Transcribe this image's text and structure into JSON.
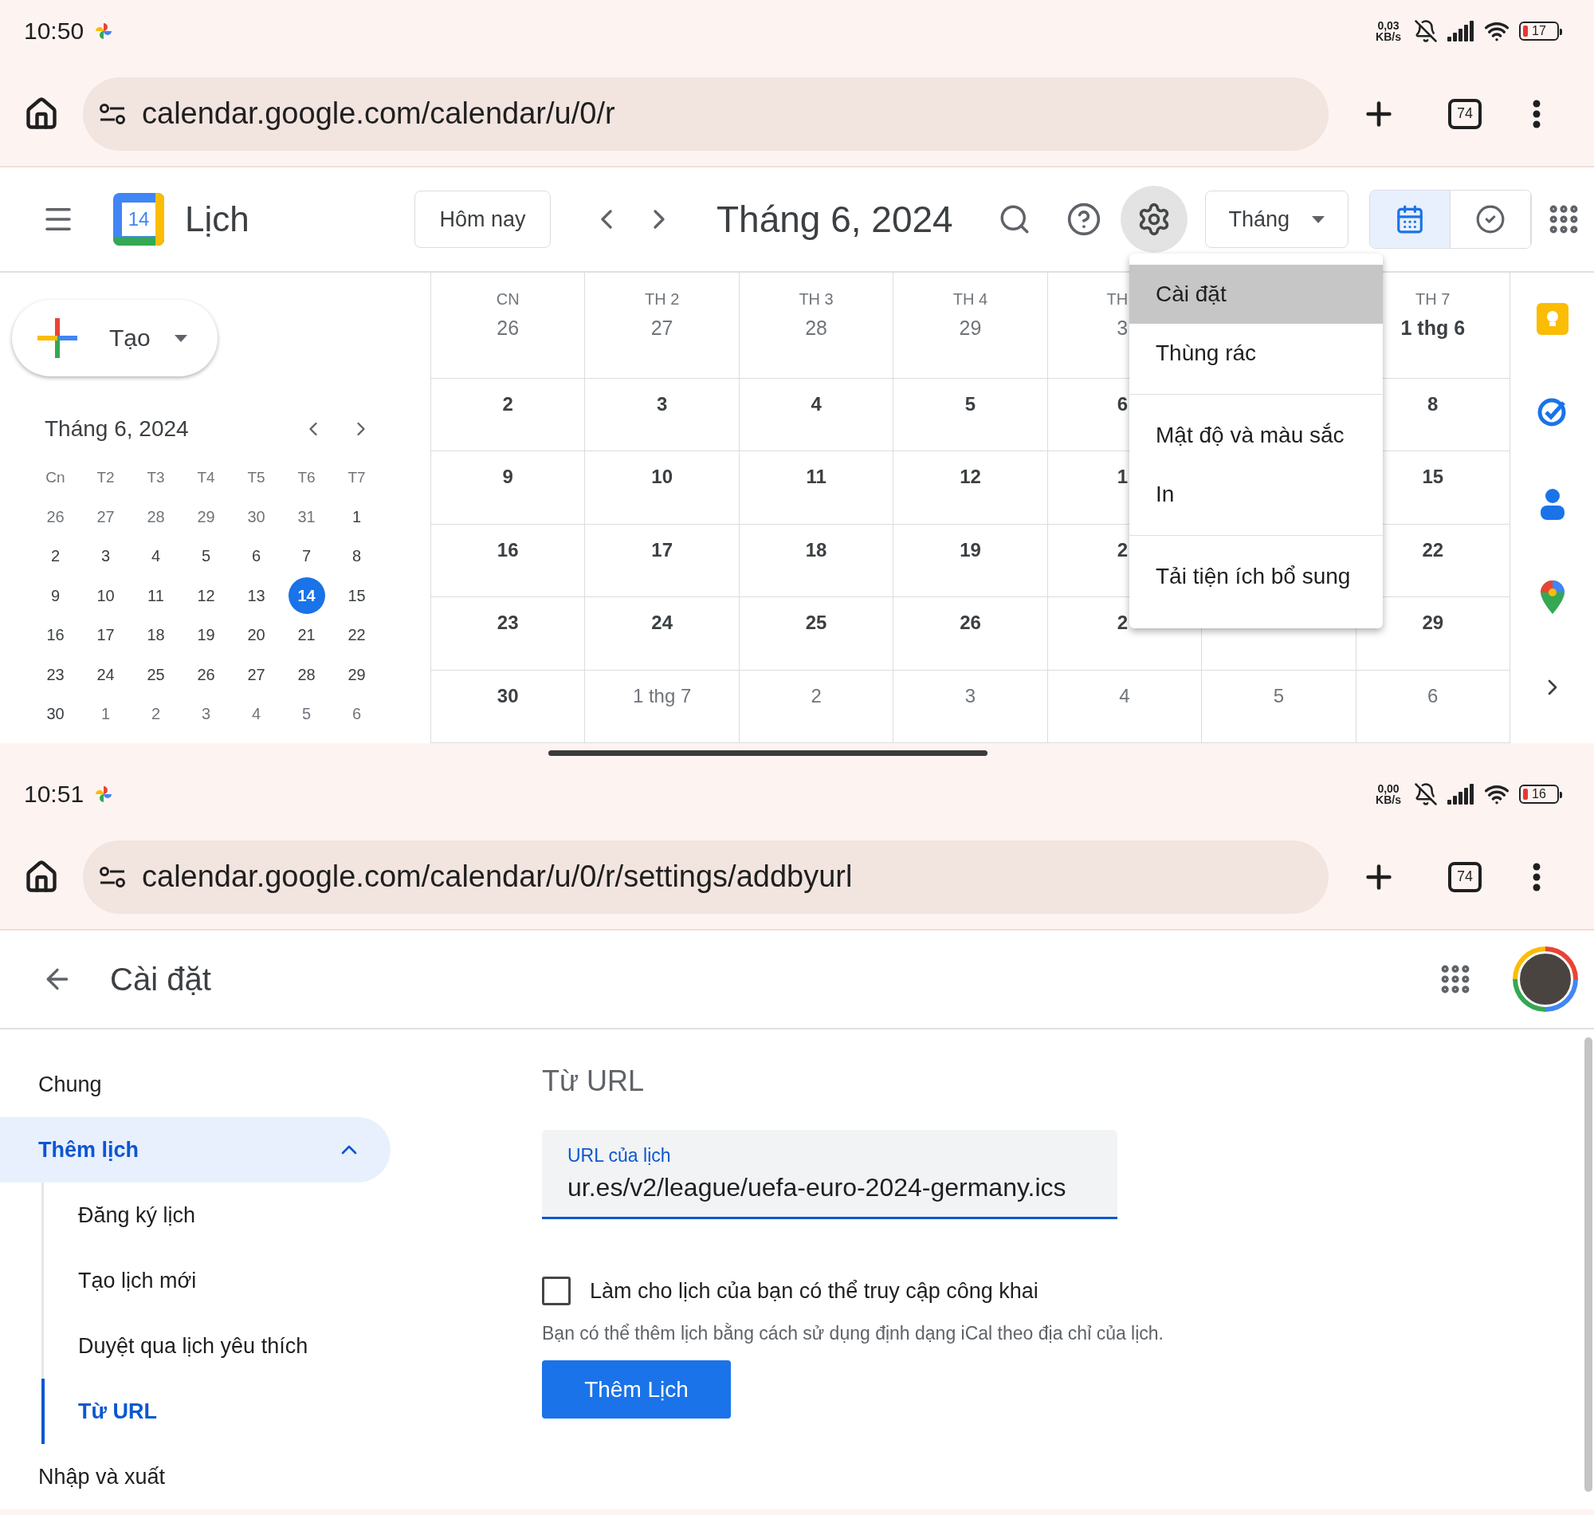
{
  "calendar_screen": {
    "status_bar": {
      "time": "10:50",
      "speed": "0,03",
      "speed_unit": "KB/s",
      "battery": "17"
    },
    "browser": {
      "url": "calendar.google.com/calendar/u/0/r",
      "tab_count": "74"
    },
    "header": {
      "logo_date": "14",
      "app_name": "Lịch",
      "today_button": "Hôm nay",
      "title": "Tháng 6, 2024",
      "settings_pressed": true,
      "view_select": "Tháng",
      "view_toggles": [
        {
          "kind": "calendar",
          "selected": true
        },
        {
          "kind": "tasks",
          "selected": false
        }
      ]
    },
    "create_button": "Tạo",
    "mini_calendar": {
      "title": "Tháng 6, 2024",
      "weekdays": [
        "Cn",
        "T2",
        "T3",
        "T4",
        "T5",
        "T6",
        "T7"
      ],
      "weeks": [
        [
          {
            "d": "26",
            "muted": true,
            "selected": false
          },
          {
            "d": "27",
            "muted": true,
            "selected": false
          },
          {
            "d": "28",
            "muted": true,
            "selected": false
          },
          {
            "d": "29",
            "muted": true,
            "selected": false
          },
          {
            "d": "30",
            "muted": true,
            "selected": false
          },
          {
            "d": "31",
            "muted": true,
            "selected": false
          },
          {
            "d": "1",
            "muted": false,
            "selected": false
          }
        ],
        [
          {
            "d": "2",
            "muted": false,
            "selected": false
          },
          {
            "d": "3",
            "muted": false,
            "selected": false
          },
          {
            "d": "4",
            "muted": false,
            "selected": false
          },
          {
            "d": "5",
            "muted": false,
            "selected": false
          },
          {
            "d": "6",
            "muted": false,
            "selected": false
          },
          {
            "d": "7",
            "muted": false,
            "selected": false
          },
          {
            "d": "8",
            "muted": false,
            "selected": false
          }
        ],
        [
          {
            "d": "9",
            "muted": false,
            "selected": false
          },
          {
            "d": "10",
            "muted": false,
            "selected": false
          },
          {
            "d": "11",
            "muted": false,
            "selected": false
          },
          {
            "d": "12",
            "muted": false,
            "selected": false
          },
          {
            "d": "13",
            "muted": false,
            "selected": false
          },
          {
            "d": "14",
            "muted": false,
            "selected": true
          },
          {
            "d": "15",
            "muted": false,
            "selected": false
          }
        ],
        [
          {
            "d": "16",
            "muted": false,
            "selected": false
          },
          {
            "d": "17",
            "muted": false,
            "selected": false
          },
          {
            "d": "18",
            "muted": false,
            "selected": false
          },
          {
            "d": "19",
            "muted": false,
            "selected": false
          },
          {
            "d": "20",
            "muted": false,
            "selected": false
          },
          {
            "d": "21",
            "muted": false,
            "selected": false
          },
          {
            "d": "22",
            "muted": false,
            "selected": false
          }
        ],
        [
          {
            "d": "23",
            "muted": false,
            "selected": false
          },
          {
            "d": "24",
            "muted": false,
            "selected": false
          },
          {
            "d": "25",
            "muted": false,
            "selected": false
          },
          {
            "d": "26",
            "muted": false,
            "selected": false
          },
          {
            "d": "27",
            "muted": false,
            "selected": false
          },
          {
            "d": "28",
            "muted": false,
            "selected": false
          },
          {
            "d": "29",
            "muted": false,
            "selected": false
          }
        ],
        [
          {
            "d": "30",
            "muted": false,
            "selected": false
          },
          {
            "d": "1",
            "muted": true,
            "selected": false
          },
          {
            "d": "2",
            "muted": true,
            "selected": false
          },
          {
            "d": "3",
            "muted": true,
            "selected": false
          },
          {
            "d": "4",
            "muted": true,
            "selected": false
          },
          {
            "d": "5",
            "muted": true,
            "selected": false
          },
          {
            "d": "6",
            "muted": true,
            "selected": false
          }
        ]
      ]
    },
    "grid": {
      "columns": [
        {
          "label": "CN",
          "date": "26",
          "muted": true
        },
        {
          "label": "TH 2",
          "date": "27",
          "muted": true
        },
        {
          "label": "TH 3",
          "date": "28",
          "muted": true
        },
        {
          "label": "TH 4",
          "date": "29",
          "muted": true
        },
        {
          "label": "TH",
          "date": "3",
          "muted": true
        },
        null,
        {
          "label": "TH 7",
          "date": "1 thg 6",
          "muted": false
        }
      ],
      "rows": [
        [
          {
            "d": "2",
            "muted": false
          },
          {
            "d": "3",
            "muted": false
          },
          {
            "d": "4",
            "muted": false
          },
          {
            "d": "5",
            "muted": false
          },
          {
            "d": "6",
            "muted": false
          },
          null,
          {
            "d": "8",
            "muted": false
          }
        ],
        [
          {
            "d": "9",
            "muted": false
          },
          {
            "d": "10",
            "muted": false
          },
          {
            "d": "11",
            "muted": false
          },
          {
            "d": "12",
            "muted": false
          },
          {
            "d": "1",
            "muted": false
          },
          null,
          {
            "d": "15",
            "muted": false
          }
        ],
        [
          {
            "d": "16",
            "muted": false
          },
          {
            "d": "17",
            "muted": false
          },
          {
            "d": "18",
            "muted": false
          },
          {
            "d": "19",
            "muted": false
          },
          {
            "d": "2",
            "muted": false
          },
          null,
          {
            "d": "22",
            "muted": false
          }
        ],
        [
          {
            "d": "23",
            "muted": false
          },
          {
            "d": "24",
            "muted": false
          },
          {
            "d": "25",
            "muted": false
          },
          {
            "d": "26",
            "muted": false
          },
          {
            "d": "2",
            "muted": false
          },
          null,
          {
            "d": "29",
            "muted": false
          }
        ],
        [
          {
            "d": "30",
            "muted": false
          },
          {
            "d": "1 thg 7",
            "muted": true
          },
          {
            "d": "2",
            "muted": true
          },
          {
            "d": "3",
            "muted": true
          },
          {
            "d": "4",
            "muted": true
          },
          {
            "d": "5",
            "muted": true
          },
          {
            "d": "6",
            "muted": true
          }
        ]
      ]
    },
    "menu": {
      "groups": [
        [
          {
            "label": "Cài đặt",
            "selected": true
          },
          {
            "label": "Thùng rác",
            "selected": false
          }
        ],
        [
          {
            "label": "Mật độ và màu sắc",
            "selected": false
          },
          {
            "label": "In",
            "selected": false
          }
        ],
        [
          {
            "label": "Tải tiện ích bổ sung",
            "selected": false
          }
        ]
      ]
    }
  },
  "settings_screen": {
    "status_bar": {
      "time": "10:51",
      "speed": "0,00",
      "speed_unit": "KB/s",
      "battery": "16"
    },
    "browser": {
      "url": "calendar.google.com/calendar/u/0/r/settings/addbyurl",
      "tab_count": "74"
    },
    "header": {
      "title": "Cài đặt"
    },
    "sidebar": [
      {
        "label": "Chung",
        "selected": false
      },
      {
        "label": "Thêm lịch",
        "selected": true,
        "expanded": true,
        "children": [
          {
            "label": "Đăng ký lịch",
            "selected": false
          },
          {
            "label": "Tạo lịch mới",
            "selected": false
          },
          {
            "label": "Duyệt qua lịch yêu thích",
            "selected": false
          },
          {
            "label": "Từ URL",
            "selected": true
          }
        ]
      },
      {
        "label": "Nhập và xuất",
        "selected": false
      }
    ],
    "content": {
      "title": "Từ URL",
      "url_field": {
        "label": "URL của lịch",
        "value": "ur.es/v2/league/uefa-euro-2024-germany.ics"
      },
      "public_checkbox": {
        "label": "Làm cho lịch của bạn có thể truy cập công khai",
        "checked": false
      },
      "help": "Bạn có thể thêm lịch bằng cách sử dụng định dạng iCal theo địa chỉ của lịch.",
      "submit": "Thêm Lịch"
    }
  }
}
